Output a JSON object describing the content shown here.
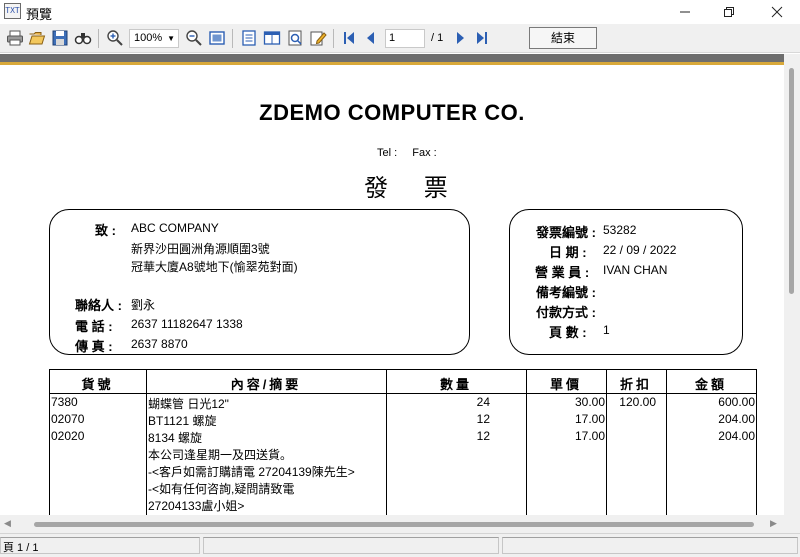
{
  "window": {
    "title": "預覽",
    "icon": "preview-app-icon"
  },
  "toolbar": {
    "zoom": "100%",
    "page_current": "1",
    "page_total": "/ 1",
    "close_label": "結束",
    "icons": [
      "print-icon",
      "open-folder-icon",
      "save-icon",
      "find-icon",
      "zoom-in-icon",
      "zoom-out-icon",
      "fit-page-icon",
      "single-page-icon",
      "two-page-icon",
      "export-icon",
      "edit-icon",
      "first-page-icon",
      "prev-page-icon",
      "next-page-icon",
      "last-page-icon"
    ]
  },
  "report": {
    "company": "ZDEMO COMPUTER CO.",
    "tel_label": "Tel :",
    "fax_label": "Fax :",
    "title": "發  票",
    "customer": {
      "to_label": "致 :",
      "name": "ABC COMPANY",
      "address_line1": "新界沙田圓洲角源順圍3號",
      "address_line2": "冠華大廈A8號地下(愉翠苑對面)",
      "contact_label": "聯絡人 :",
      "contact": "劉永",
      "phone_label": "電  話 :",
      "phone": "2637 11182647 1338",
      "fax_label": "傳  真 :",
      "fax": "2637 8870"
    },
    "invoice": {
      "no_label": "發票編號 :",
      "no": "53282",
      "date_label": "日  期 :",
      "date": "22 / 09 / 2022",
      "sales_label": "營 業 員 :",
      "sales": "IVAN CHAN",
      "ref_label": "備考編號 :",
      "ref": "",
      "payment_label": "付款方式 :",
      "payment": "",
      "pages_label": "頁  數 :",
      "pages": "1"
    },
    "table": {
      "headers": [
        "貨號",
        "內容/摘要",
        "數量",
        "單價",
        "折扣",
        "金額"
      ],
      "rows": [
        {
          "code": "7380",
          "desc": "蝴蝶管 日光12\"",
          "qty": "24",
          "price": "30.00",
          "discount": "120.00",
          "amount": "600.00"
        },
        {
          "code": "02070",
          "desc": "BT1121 螺旋",
          "qty": "12",
          "price": "17.00",
          "discount": "",
          "amount": "204.00"
        },
        {
          "code": "02020",
          "desc": "8134 螺旋",
          "qty": "12",
          "price": "17.00",
          "discount": "",
          "amount": "204.00"
        }
      ],
      "notes": [
        "本公司逢星期一及四送貨。",
        "-<客戶如需訂購請電 27204139陳先生>",
        "-<如有任何咨詢,疑問請致電",
        "27204133盧小姐>"
      ]
    }
  },
  "statusbar": {
    "page_info": "頁 1 / 1"
  }
}
